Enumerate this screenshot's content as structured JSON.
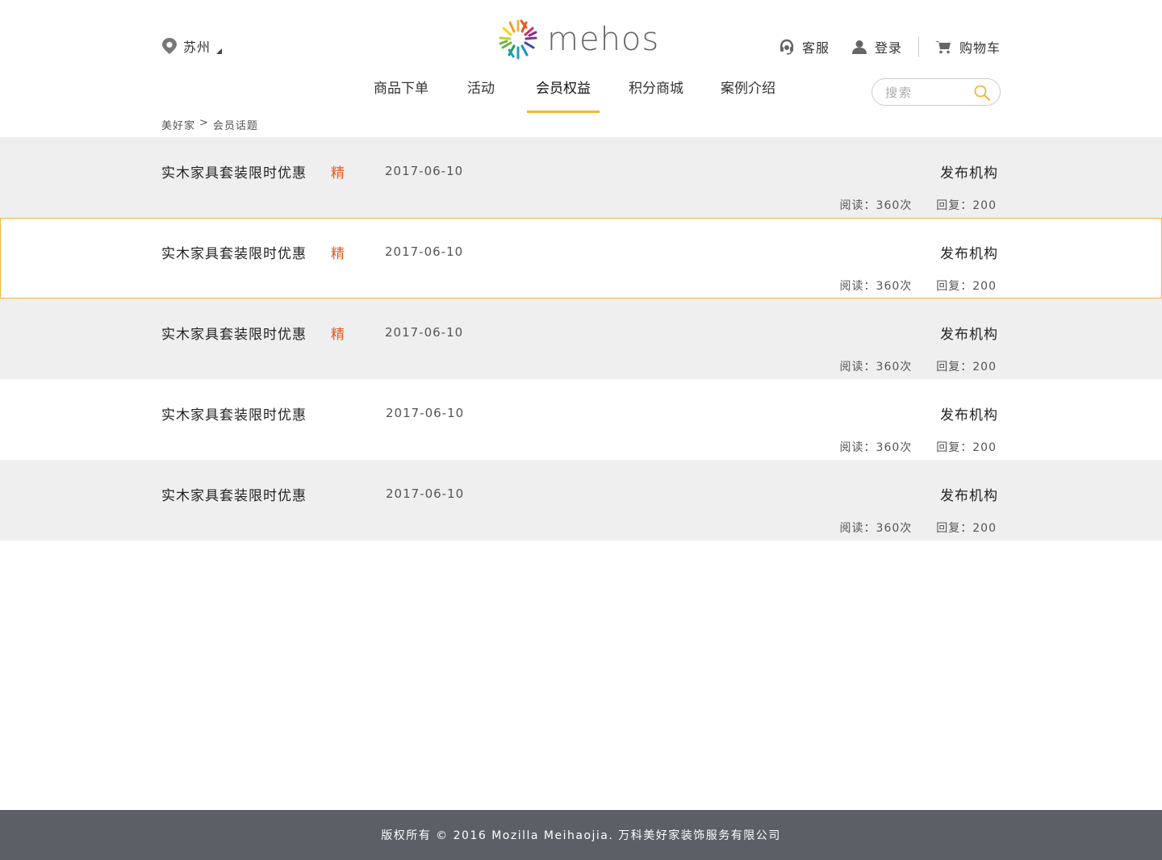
{
  "header": {
    "city": "苏州",
    "logo_text": "mehos",
    "service_label": "客服",
    "login_label": "登录",
    "cart_label": "购物车"
  },
  "nav": {
    "tabs": [
      {
        "label": "商品下单"
      },
      {
        "label": "活动"
      },
      {
        "label": "会员权益"
      },
      {
        "label": "积分商城"
      },
      {
        "label": "案例介绍"
      }
    ],
    "active_tab": "会员权益"
  },
  "search": {
    "placeholder": "搜索"
  },
  "breadcrumb": {
    "home": "美好家",
    "separator": ">",
    "current": "会员话题"
  },
  "topics": [
    {
      "title": "实木家具套装限时优惠",
      "badge": "精",
      "date": "2017-06-10",
      "publisher": "发布机构",
      "reads": "阅读：360次",
      "replies": "回复：200"
    },
    {
      "title": "实木家具套装限时优惠",
      "badge": "精",
      "date": "2017-06-10",
      "publisher": "发布机构",
      "reads": "阅读：360次",
      "replies": "回复：200"
    },
    {
      "title": "实木家具套装限时优惠",
      "badge": "精",
      "date": "2017-06-10",
      "publisher": "发布机构",
      "reads": "阅读：360次",
      "replies": "回复：200"
    },
    {
      "title": "实木家具套装限时优惠",
      "badge": "",
      "date": "2017-06-10",
      "publisher": "发布机构",
      "reads": "阅读：360次",
      "replies": "回复：200"
    },
    {
      "title": "实木家具套装限时优惠",
      "badge": "",
      "date": "2017-06-10",
      "publisher": "发布机构",
      "reads": "阅读：360次",
      "replies": "回复：200"
    }
  ],
  "footer": {
    "copyright": "版权所有 © 2016 Mozilla Meihaojia. 万科美好家装饰服务有限公司"
  },
  "colors": {
    "accent": "#f2b53a",
    "badge": "#e8581c",
    "row_gray": "#efefef",
    "footer_bg": "#5d5f66"
  }
}
